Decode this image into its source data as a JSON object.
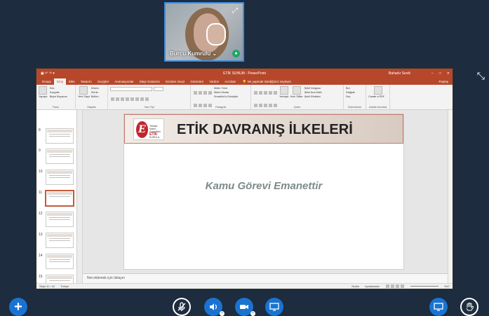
{
  "webcam": {
    "name": "Burcu Kumrulu",
    "chevron": "⌄"
  },
  "ppt": {
    "window_title": "ETİK SUNUM  -  PowerPoint",
    "user": "Bahadır Sevik",
    "tabs": [
      "Dosya",
      "Giriş",
      "Ekle",
      "Tasarım",
      "Geçişler",
      "Animasyonlar",
      "Slayt Gösterisi",
      "Gözden Geçir",
      "Görünüm",
      "Yardım",
      "Acrobat"
    ],
    "active_tab": "Giriş",
    "tell_me": "Ne yapmak istediğinizi söyleyin",
    "share": "Paylaş",
    "ribbon": {
      "paste": "Yapıştır",
      "cut": "Kes",
      "copy": "Kopyala",
      "format_painter": "Biçim Boyacısı",
      "clipboard": "Pano",
      "new_slide": "Yeni Slayt",
      "layout": "Düzen",
      "reset": "Sıfırla",
      "section": "Bölüm",
      "slides": "Slaytlar",
      "font": "Yazı Tipi",
      "text_direction": "Metin Yönü",
      "align_text": "Metni Hizala",
      "smartart": "SmartArt'a Dönüştür",
      "paragraph": "Paragraf",
      "arrange": "Yerleştir",
      "quick_styles": "Hızlı Stiller",
      "drawing": "Çizim",
      "shape_fill": "Şekil Dolgusu",
      "shape_outline": "Şekil Ana Hattı",
      "shape_effects": "Şekil Efektleri",
      "find": "Bul",
      "replace": "Değiştir",
      "select": "Seç",
      "editing": "Düzenleme",
      "create_pdf": "Create a PDF",
      "adobe": "Adobe Acrobat"
    },
    "thumb_numbers": [
      "8",
      "9",
      "10",
      "11",
      "12",
      "13",
      "14",
      "15"
    ],
    "slide": {
      "logo_letter": "E",
      "logo_line1": "Türkiye",
      "logo_line2": "Kamu Görevlileri",
      "logo_line3": "ETİK",
      "logo_line4": "KURULU",
      "title": "ETİK DAVRANIŞ İLKELERİ",
      "subtitle": "Kamu Görevi Emanettir"
    },
    "notes": "Not eklemek için tıklayın",
    "status": {
      "slide": "Slayt 11 / 42",
      "language": "Türkçe",
      "notes_btn": "Notlar",
      "comments_btn": "Açıklamalar",
      "zoom": "%47"
    }
  },
  "controls": {
    "plus": "+",
    "mute": "🎙",
    "audio": "🔊",
    "video": "▶",
    "screen": "🖵",
    "hand": "✋"
  }
}
